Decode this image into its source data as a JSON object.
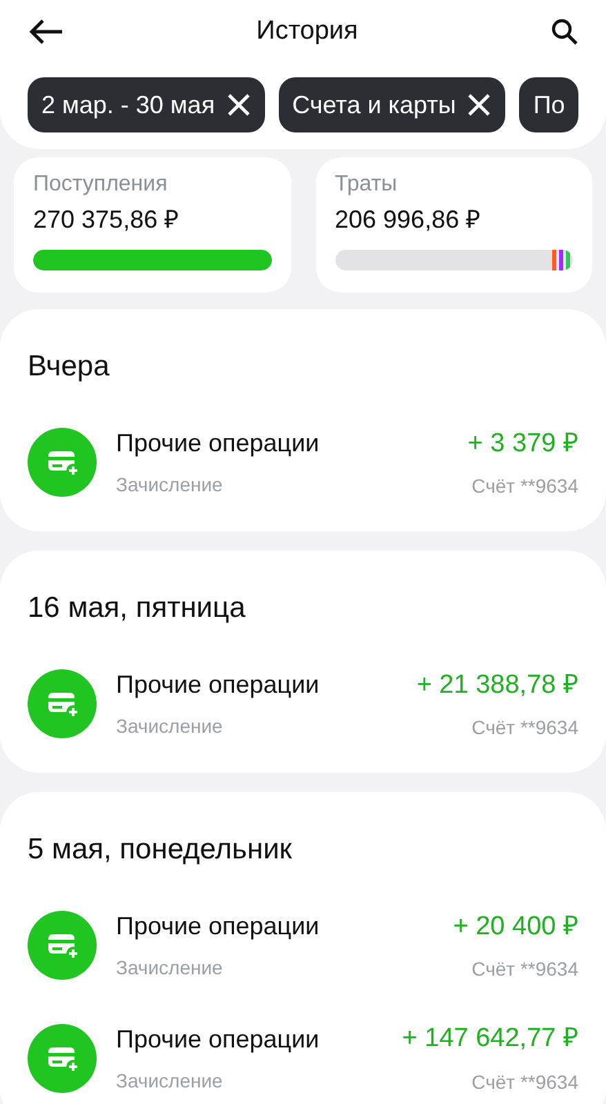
{
  "header": {
    "title": "История"
  },
  "chips": [
    {
      "label": "2 мар. - 30 мая",
      "removable": true
    },
    {
      "label": "Счета и карты",
      "removable": true
    },
    {
      "label": "По",
      "removable": false
    }
  ],
  "summary": [
    {
      "label": "Поступления",
      "amount": "270 375,86 ₽",
      "level": 1
    },
    {
      "label": "Траты",
      "amount": "206 996,86 ₽",
      "segments": [
        {
          "color": "#ff5a1f"
        },
        {
          "color": "#9b30ff"
        },
        {
          "color": "#2fc85a"
        }
      ]
    }
  ],
  "groups": [
    {
      "date": "Вчера",
      "items": [
        {
          "title": "Прочие операции",
          "subtitle": "Зачисление",
          "amount": "+ 3 379 ₽",
          "account": "Счёт **9634"
        }
      ]
    },
    {
      "date": "16 мая, пятница",
      "items": [
        {
          "title": "Прочие операции",
          "subtitle": "Зачисление",
          "amount": "+ 21 388,78 ₽",
          "account": "Счёт **9634"
        }
      ]
    },
    {
      "date": "5 мая, понедельник",
      "items": [
        {
          "title": "Прочие операции",
          "subtitle": "Зачисление",
          "amount": "+ 20 400 ₽",
          "account": "Счёт **9634"
        },
        {
          "title": "Прочие операции",
          "subtitle": "Зачисление",
          "amount": "+ 147 642,77 ₽",
          "account": "Счёт **9634"
        }
      ]
    }
  ]
}
